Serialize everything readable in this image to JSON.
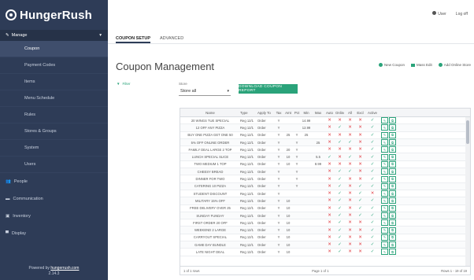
{
  "brand": {
    "name": "HungerRush"
  },
  "sidebar": {
    "section_label": "Manage",
    "sub_items": [
      "Coupon",
      "Payment Codes",
      "Items",
      "Menu Schedule",
      "Rules",
      "Stores & Groups",
      "System",
      "Users"
    ],
    "main_items": [
      "People",
      "Communication",
      "Inventory",
      "Display"
    ],
    "footer_text": "Powered by",
    "footer_link": "hungerrush.com",
    "footer_version": "2.14.3"
  },
  "topbar": {
    "user": "User",
    "logout": "Log off"
  },
  "tabs": [
    "COUPON SETUP",
    "ADVANCED"
  ],
  "page": {
    "title": "Coupon Management",
    "actions": [
      "New Coupon",
      "Mass Edit",
      "Add Online Store"
    ],
    "filter_label": "Filter",
    "store_label": "Store",
    "store_value": "Store all",
    "primary_button": "DOWNLOAD COUPON REPORT"
  },
  "table": {
    "headers": [
      "Name",
      "Type",
      "Apply To",
      "Tax",
      "Amt",
      "Pct",
      "Min",
      "Max",
      "Auto",
      "Online",
      "All",
      "Mon",
      "Excl",
      "Edit",
      "Active",
      ""
    ],
    "rows": [
      {
        "name": "20 WINGS TUE SPECIAL",
        "type": "Reg 12/1",
        "apply": "Order",
        "tax": "Y",
        "amt": "",
        "pct": "",
        "min": "14.99",
        "max": "",
        "f": [
          "x",
          "x",
          "x",
          "x",
          "ok"
        ]
      },
      {
        "name": "12 OFF ANY PIZZA",
        "type": "Reg 12/1",
        "apply": "Order",
        "tax": "Y",
        "amt": "",
        "pct": "",
        "min": "12.99",
        "max": "",
        "f": [
          "x",
          "ok",
          "x",
          "x",
          "ok"
        ]
      },
      {
        "name": "BUY ONE PIZZA GET ONE 50",
        "type": "Reg 12/1",
        "apply": "Order",
        "tax": "Y",
        "amt": "25",
        "pct": "Y",
        "min": "25",
        "max": "",
        "f": [
          "x",
          "x",
          "x",
          "x",
          "ok"
        ]
      },
      {
        "name": "5% OFF ONLINE ORDER",
        "type": "Reg 12/1",
        "apply": "Order",
        "tax": "Y",
        "amt": "",
        "pct": "Y",
        "min": "",
        "max": "25",
        "f": [
          "x",
          "ok",
          "ok",
          "x",
          "ok"
        ]
      },
      {
        "name": "FAMILY DEAL LARGE 2 TOP",
        "type": "Reg 12/1",
        "apply": "Order",
        "tax": "Y",
        "amt": "20",
        "pct": "Y",
        "min": "",
        "max": "",
        "f": [
          "x",
          "x",
          "x",
          "x",
          "ok"
        ]
      },
      {
        "name": "LUNCH SPECIAL SLICE",
        "type": "Reg 12/1",
        "apply": "Order",
        "tax": "Y",
        "amt": "10",
        "pct": "Y",
        "min": "",
        "max": "5.5",
        "f": [
          "ok",
          "x",
          "ok",
          "x",
          "ok"
        ]
      },
      {
        "name": "TWO MEDIUM 1 TOP",
        "type": "Reg 12/1",
        "apply": "Order",
        "tax": "Y",
        "amt": "10",
        "pct": "Y",
        "min": "",
        "max": "8.99",
        "f": [
          "x",
          "x",
          "x",
          "x",
          "ok"
        ]
      },
      {
        "name": "CHEESY BREAD",
        "type": "Reg 12/1",
        "apply": "Order",
        "tax": "Y",
        "amt": "",
        "pct": "Y",
        "min": "",
        "max": "",
        "f": [
          "x",
          "ok",
          "ok",
          "x",
          "ok"
        ]
      },
      {
        "name": "DINNER FOR TWO",
        "type": "Reg 12/1",
        "apply": "Order",
        "tax": "Y",
        "amt": "",
        "pct": "Y",
        "min": "",
        "max": "",
        "f": [
          "x",
          "ok",
          "x",
          "x",
          "ok"
        ]
      },
      {
        "name": "CATERING 10 PIZZA",
        "type": "Reg 12/1",
        "apply": "Order",
        "tax": "Y",
        "amt": "",
        "pct": "Y",
        "min": "",
        "max": "",
        "f": [
          "x",
          "ok",
          "x",
          "ok",
          "ok"
        ]
      },
      {
        "name": "STUDENT DISCOUNT",
        "type": "Reg 12/1",
        "apply": "Order",
        "tax": "Y",
        "amt": "",
        "pct": "",
        "min": "",
        "max": "",
        "f": [
          "x",
          "ok",
          "x",
          "ok",
          "x"
        ]
      },
      {
        "name": "MILITARY 15% OFF",
        "type": "Reg 12/1",
        "apply": "Order",
        "tax": "Y",
        "amt": "10",
        "pct": "",
        "min": "",
        "max": "",
        "f": [
          "x",
          "ok",
          "x",
          "ok",
          "ok"
        ]
      },
      {
        "name": "FREE DELIVERY OVER 25",
        "type": "Reg 12/1",
        "apply": "Order",
        "tax": "Y",
        "amt": "10",
        "pct": "",
        "min": "",
        "max": "",
        "f": [
          "x",
          "ok",
          "x",
          "ok",
          "ok"
        ]
      },
      {
        "name": "SUNDAY FUNDAY",
        "type": "Reg 12/1",
        "apply": "Order",
        "tax": "Y",
        "amt": "10",
        "pct": "",
        "min": "",
        "max": "",
        "f": [
          "x",
          "ok",
          "x",
          "ok",
          "ok"
        ]
      },
      {
        "name": "FIRST ORDER 20 OFF",
        "type": "Reg 12/1",
        "apply": "Order",
        "tax": "Y",
        "amt": "10",
        "pct": "",
        "min": "",
        "max": "",
        "f": [
          "x",
          "ok",
          "x",
          "x",
          "ok"
        ]
      },
      {
        "name": "WEEKEND 2 LARGE",
        "type": "Reg 12/1",
        "apply": "Order",
        "tax": "Y",
        "amt": "10",
        "pct": "",
        "min": "",
        "max": "",
        "f": [
          "x",
          "ok",
          "x",
          "x",
          "ok"
        ]
      },
      {
        "name": "CARRYOUT SPECIAL",
        "type": "Reg 12/1",
        "apply": "Order",
        "tax": "Y",
        "amt": "10",
        "pct": "",
        "min": "",
        "max": "",
        "f": [
          "x",
          "ok",
          "x",
          "x",
          "ok"
        ]
      },
      {
        "name": "GAME DAY BUNDLE",
        "type": "Reg 12/1",
        "apply": "Order",
        "tax": "Y",
        "amt": "10",
        "pct": "",
        "min": "",
        "max": "",
        "f": [
          "x",
          "ok",
          "x",
          "x",
          "ok"
        ]
      },
      {
        "name": "LATE NIGHT DEAL",
        "type": "Reg 12/1",
        "apply": "Order",
        "tax": "Y",
        "amt": "10",
        "pct": "",
        "min": "",
        "max": "",
        "f": [
          "x",
          "ok",
          "x",
          "x",
          "ok"
        ]
      }
    ],
    "footer_left": "1 of 1 rows",
    "footer_mid": "Page 1 of 1",
    "footer_right": "Rows 1 - 19 of 19"
  },
  "colors": {
    "sidebar": "#2e3c57",
    "accent": "#2aa37a",
    "error": "#e0383e"
  }
}
